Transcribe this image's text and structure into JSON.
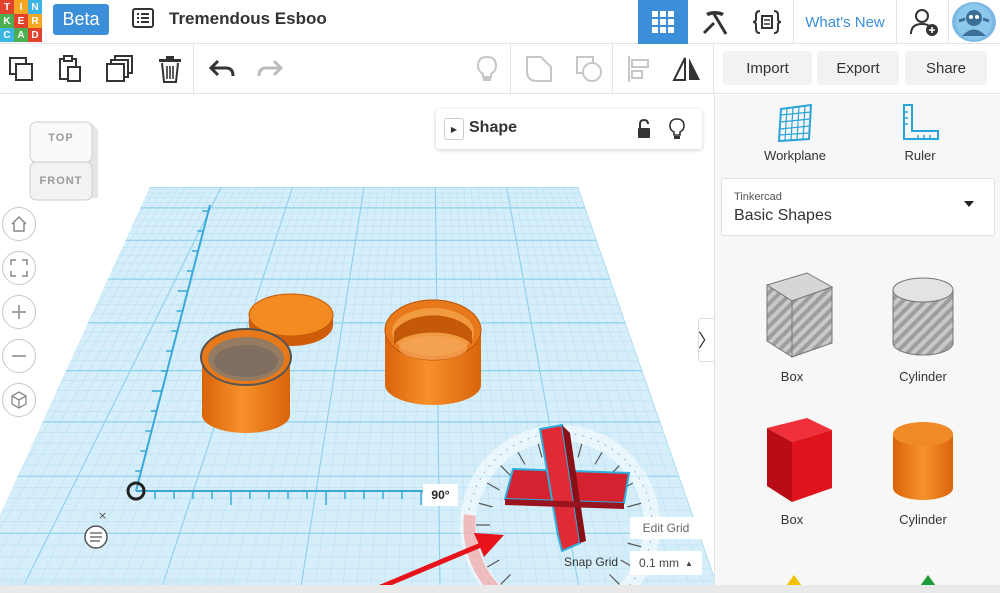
{
  "topbar": {
    "logo_letters": [
      "T",
      "I",
      "N",
      "K",
      "E",
      "R",
      "C",
      "A",
      "D"
    ],
    "logo_colors": [
      "#e2412b",
      "#f5a623",
      "#3bb5e5",
      "#4caf50",
      "#e2412b",
      "#f5a623",
      "#3bb5e5",
      "#4caf50",
      "#e2412b"
    ],
    "beta_label": "Beta",
    "doc_title": "Tremendous Esboo",
    "whats_new_label": "What's New",
    "icons": [
      "design-list-icon",
      "3d-view-icon",
      "blocks-pickaxe-icon",
      "code-blocks-icon",
      "add-user-icon",
      "avatar-icon"
    ]
  },
  "toolbar": {
    "import_label": "Import",
    "export_label": "Export",
    "share_label": "Share",
    "icons": [
      "copy-icon",
      "paste-icon",
      "duplicate-icon",
      "delete-icon",
      "undo-icon",
      "redo-icon",
      "light-bulb-icon",
      "group-icon",
      "ungroup-icon",
      "align-icon",
      "mirror-icon"
    ]
  },
  "viewcube": {
    "top_label": "TOP",
    "front_label": "FRONT"
  },
  "nav_icons": [
    "home-view-icon",
    "fit-view-icon",
    "zoom-in-icon",
    "zoom-out-icon",
    "perspective-icon"
  ],
  "shape_panel": {
    "title": "Shape",
    "icons": [
      "unlock-icon",
      "light-bulb-icon"
    ]
  },
  "grid_controls": {
    "angle": "90°",
    "edit_grid_label": "Edit Grid",
    "snap_grid_label": "Snap Grid",
    "snap_grid_value": "0.1 mm"
  },
  "right_panel": {
    "workplane_label": "Workplane",
    "ruler_label": "Ruler",
    "library_small": "Tinkercad",
    "library_name": "Basic Shapes",
    "shapes": [
      {
        "label": "Box",
        "style": "hole",
        "color": "#b5b5b5"
      },
      {
        "label": "Cylinder",
        "style": "hole",
        "color": "#b5b5b5"
      },
      {
        "label": "Box",
        "style": "solid",
        "color": "#e0121c"
      },
      {
        "label": "Cylinder",
        "style": "solid",
        "color": "#ef7a14"
      }
    ]
  },
  "colors": {
    "accent": "#3b8ed8",
    "grid": "#bfe4f5",
    "shape_orange": "#ef7a14",
    "selected_red": "#d42231",
    "arrow_red": "#e8121a"
  }
}
